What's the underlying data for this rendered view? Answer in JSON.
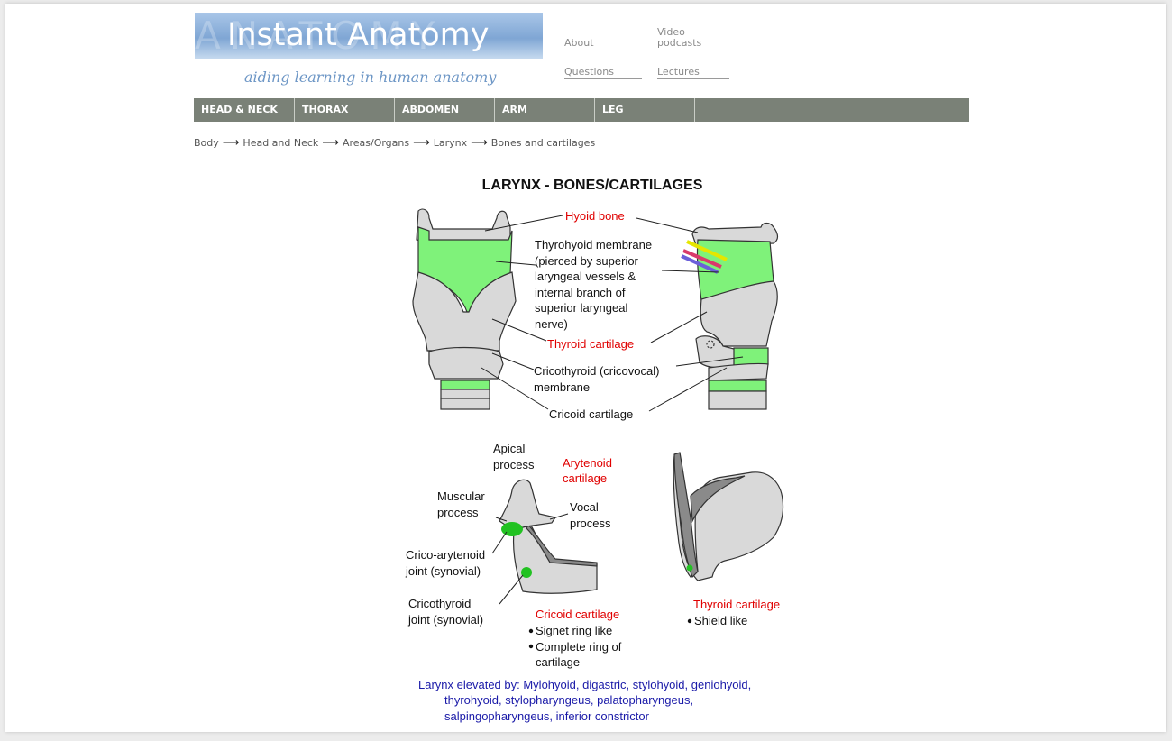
{
  "site": {
    "logo_title": "Instant Anatomy",
    "logo_watermark": "ANATOMY",
    "tagline": "aiding learning in human anatomy"
  },
  "top_links": {
    "about": "About",
    "video_line1": "Video",
    "video_line2": "podcasts",
    "questions": "Questions",
    "lectures": "Lectures"
  },
  "nav": [
    "HEAD & NECK",
    "THORAX",
    "ABDOMEN",
    "ARM",
    "LEG",
    ""
  ],
  "breadcrumb": [
    "Body",
    "Head and Neck",
    "Areas/Organs",
    "Larynx",
    "Bones and cartilages"
  ],
  "figure": {
    "title": "LARYNX - BONES/CARTILAGES",
    "labels": {
      "hyoid": "Hyoid bone",
      "thyrohyoid": [
        "Thyrohyoid membrane",
        "(pierced by superior",
        "laryngeal vessels &",
        "internal branch of",
        "superior laryngeal",
        "nerve)"
      ],
      "thyroid": "Thyroid cartilage",
      "cricothyroid_membrane": [
        "Cricothyroid (cricovocal)",
        "membrane"
      ],
      "cricoid": "Cricoid cartilage",
      "apical": [
        "Apical",
        "process"
      ],
      "arytenoid": [
        "Arytenoid",
        "cartilage"
      ],
      "muscular": [
        "Muscular",
        "process"
      ],
      "vocal": [
        "Vocal",
        "process"
      ],
      "crico_arytenoid": [
        "Crico-arytenoid",
        "joint (synovial)"
      ],
      "cricothyroid_joint": [
        "Cricothyroid",
        "joint (synovial)"
      ],
      "cricoid_title": "Cricoid cartilage",
      "cricoid_points": [
        "Signet ring like",
        "Complete ring of",
        "cartilage"
      ],
      "thyroid_title": "Thyroid cartilage",
      "thyroid_points": [
        "Shield like"
      ],
      "elevated": [
        "Larynx elevated by: Mylohyoid, digastric, stylohyoid, geniohyoid,",
        "thyrohyoid, stylopharyngeus, palatopharyngeus,",
        "salpingopharyngeus, inferior constrictor"
      ]
    },
    "colors": {
      "label_red": "#e00000",
      "label_blue": "#1a1aa8",
      "cartilage": "#d9d9d9",
      "membrane": "#7ff27a",
      "navbar": "#7a8177"
    }
  }
}
